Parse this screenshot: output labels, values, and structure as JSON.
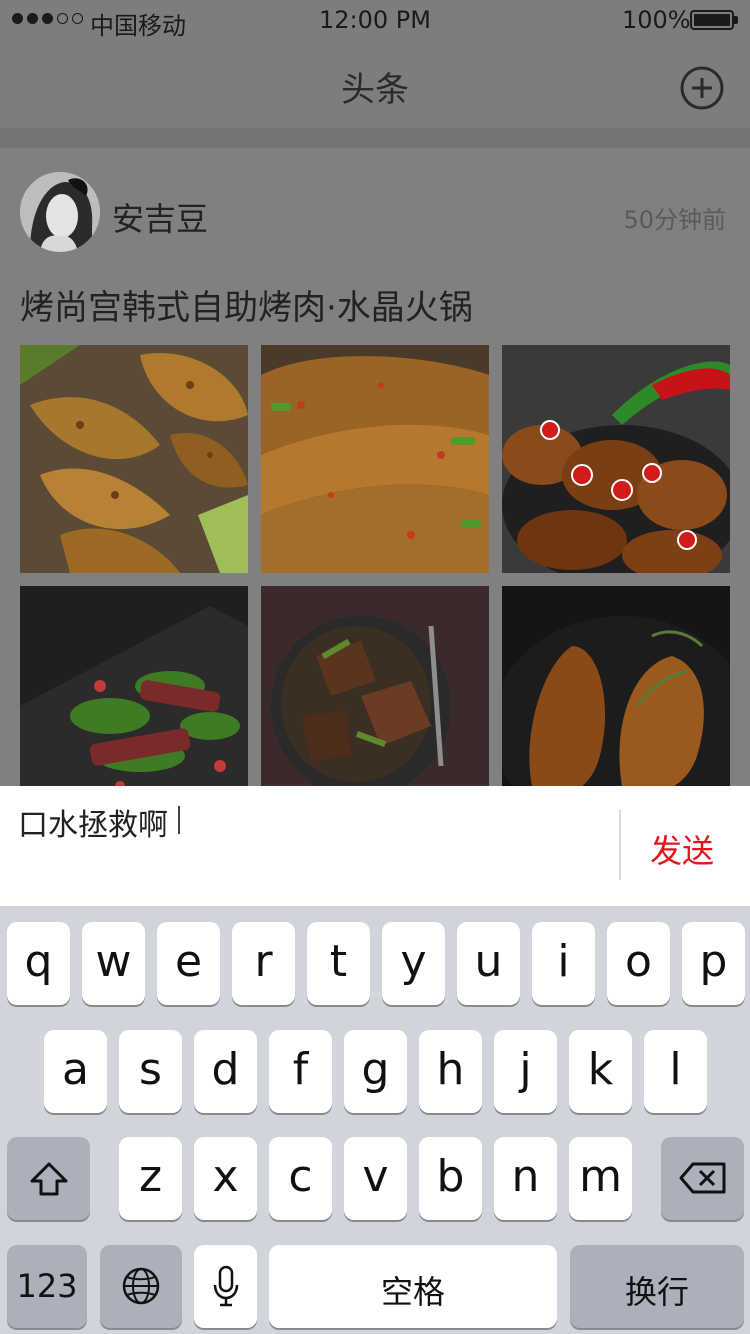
{
  "status_bar": {
    "carrier": "中国移动",
    "time": "12:00 PM",
    "battery": "100%"
  },
  "nav": {
    "title": "头条",
    "add_icon": "plus-circle-icon"
  },
  "post": {
    "author": "安吉豆",
    "time_ago": "50分钟前",
    "title": "烤尚宫韩式自助烤肉·水晶火锅",
    "photos": [
      "sliced-grilled-chicken",
      "grilled-chicken-with-scallions",
      "chicken-wings-with-chili",
      "seared-beef-salad",
      "beef-stir-fry-in-bowl",
      "roasted-duck-legs"
    ]
  },
  "composer": {
    "text": "口水拯救啊",
    "send_label": "发送"
  },
  "keyboard": {
    "row1": [
      "q",
      "w",
      "e",
      "r",
      "t",
      "y",
      "u",
      "i",
      "o",
      "p"
    ],
    "row2": [
      "a",
      "s",
      "d",
      "f",
      "g",
      "h",
      "j",
      "k",
      "l"
    ],
    "row3": [
      "z",
      "x",
      "c",
      "v",
      "b",
      "n",
      "m"
    ],
    "numbers_label": "123",
    "space_label": "空格",
    "return_label": "换行"
  },
  "colors": {
    "accent": "#e4151e",
    "overlay_bg": "#7d7d7d",
    "keyboard_bg": "#d1d4da"
  }
}
